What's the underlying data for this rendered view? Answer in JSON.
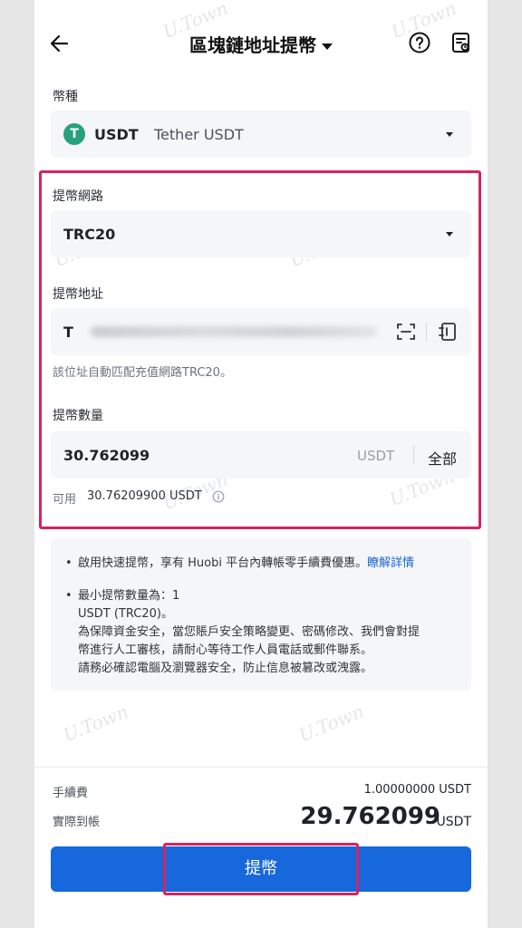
{
  "header": {
    "title": "區塊鏈地址提幣"
  },
  "currency": {
    "label": "幣種",
    "symbol": "USDT",
    "name": "Tether USDT",
    "icon_char": "T",
    "icon_color": "#26a17b"
  },
  "network": {
    "label": "提幣網路",
    "value": "TRC20"
  },
  "address": {
    "label": "提幣地址",
    "prefix": "T",
    "hint": "該位址自動匹配充值網路TRC20。"
  },
  "amount": {
    "label": "提幣數量",
    "value": "30.762099",
    "unit": "USDT",
    "all_label": "全部",
    "available_label": "可用",
    "available_value": "30.76209900 USDT"
  },
  "notice": {
    "item1_text": "啟用快速提幣，享有 Huobi 平台內轉帳零手續費優惠。",
    "item1_link": "瞭解詳情",
    "item2_lines": [
      "最小提幣數量為：1",
      "USDT (TRC20)。",
      "為保障資金安全，當您賬戶安全策略變更、密碼修改、我們會對提",
      "幣進行人工審核，請耐心等待工作人員電話或郵件聯系。",
      "請務必確認電腦及瀏覽器安全，防止信息被篡改或洩露。"
    ]
  },
  "summary": {
    "fee_label": "手續費",
    "fee_value": "1.00000000 USDT",
    "net_label": "實際到帳",
    "net_value": "29.762099",
    "net_unit": "USDT"
  },
  "submit": {
    "label": "提幣"
  },
  "watermark_text": "U.Town",
  "colors": {
    "accent": "#1668dc",
    "highlight": "#d6245c",
    "link": "#1665d8"
  }
}
